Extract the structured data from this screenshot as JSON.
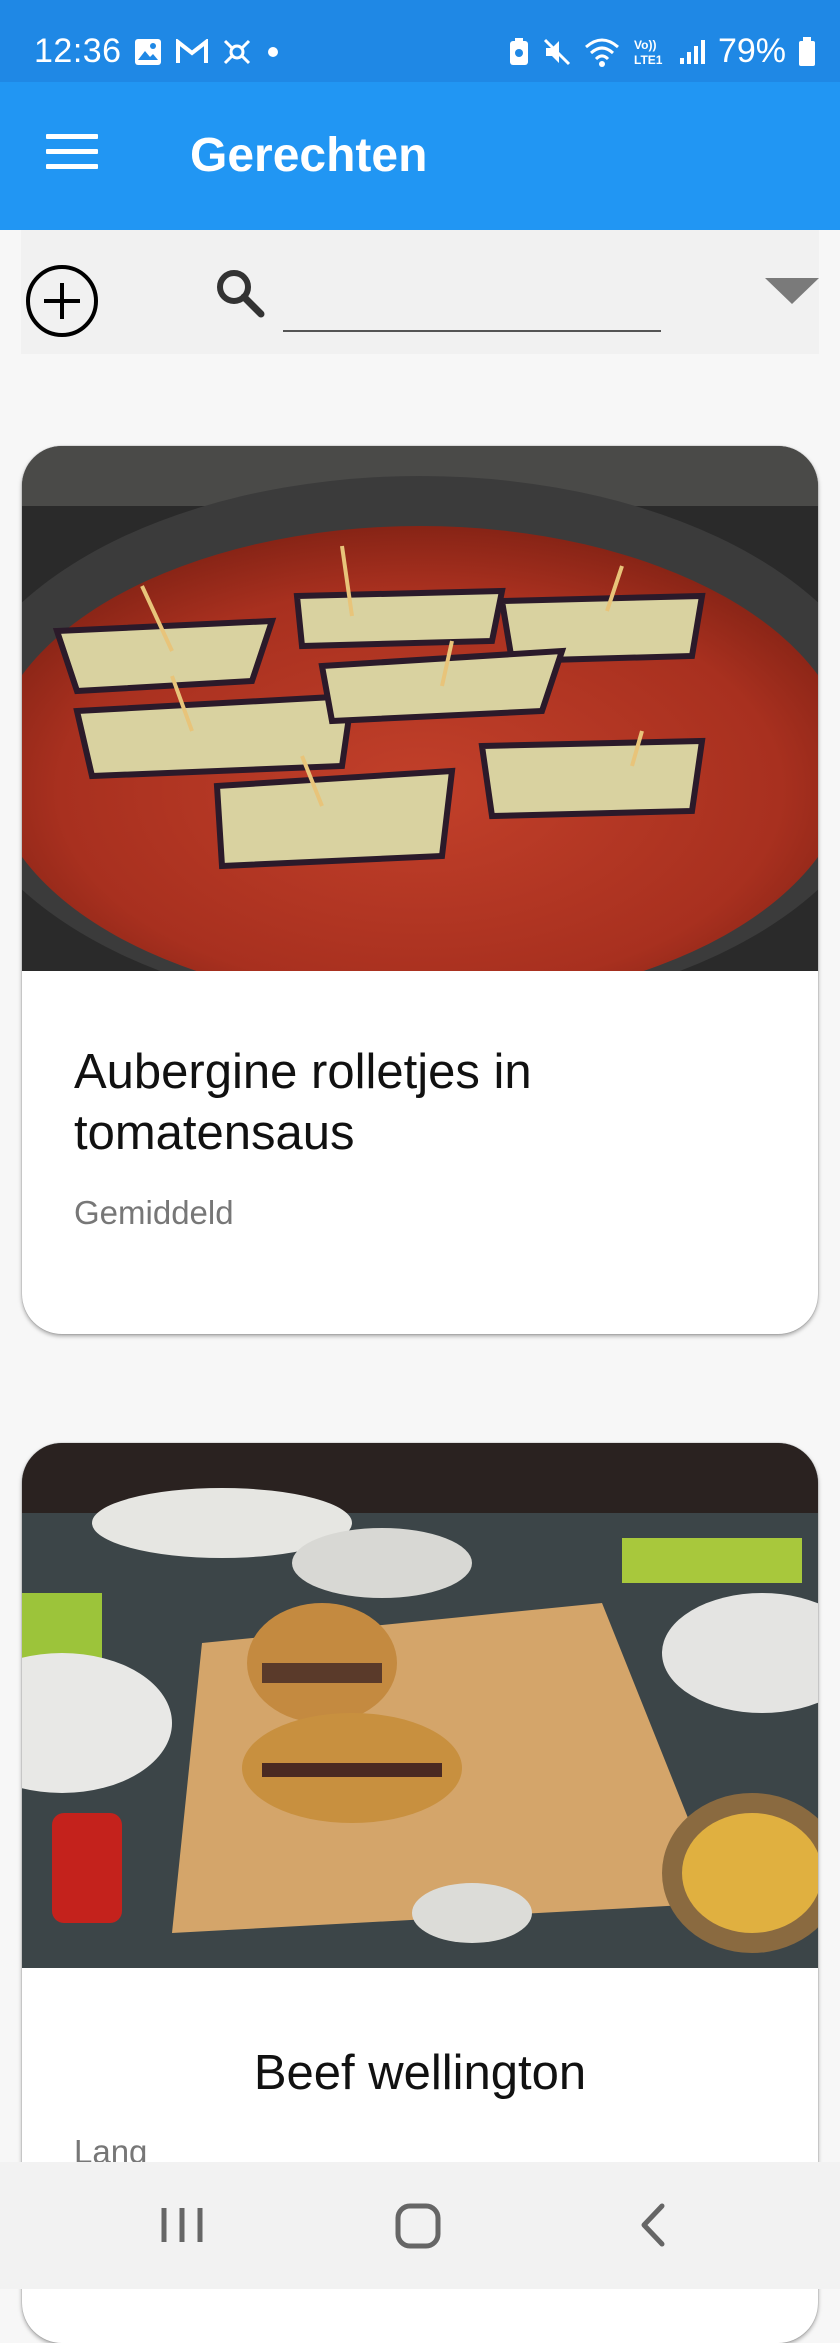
{
  "status_bar": {
    "time": "12:36",
    "battery_text": "79%",
    "icons": [
      "image-icon",
      "gmail-icon",
      "app-icon",
      "dot-icon",
      "battery-saver-icon",
      "mute-icon",
      "wifi-icon",
      "volte-icon",
      "signal-icon",
      "battery-icon"
    ]
  },
  "app_bar": {
    "title": "Gerechten",
    "menu_icon": "hamburger-menu-icon"
  },
  "toolbar": {
    "add_icon": "add-circle-icon",
    "search_icon": "search-icon",
    "search_value": "",
    "search_placeholder": "",
    "dropdown_icon": "dropdown-arrow-icon"
  },
  "recipes": [
    {
      "title": "Aubergine rolletjes in tomatensaus",
      "duration": "Gemiddeld"
    },
    {
      "title": "Beef wellington",
      "duration": "Lang"
    }
  ],
  "nav_bar": {
    "recents_icon": "recents-icon",
    "home_icon": "home-icon",
    "back_icon": "back-icon"
  },
  "colors": {
    "status_bar": "#1f88e5",
    "app_bar": "#2196f3",
    "background": "#f7f7f7"
  }
}
